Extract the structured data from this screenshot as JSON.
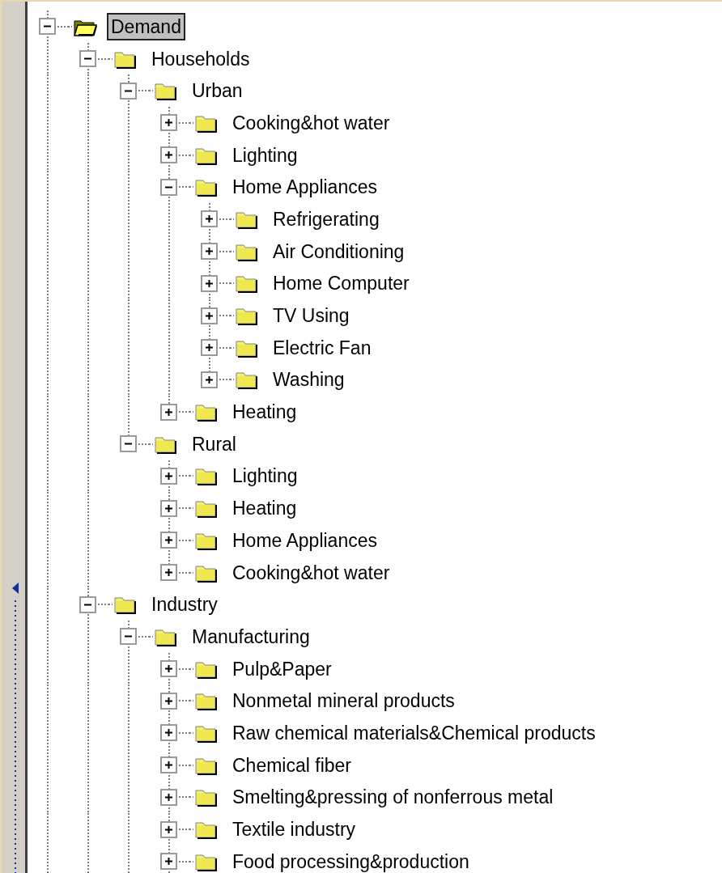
{
  "tree": [
    {
      "label": "Demand",
      "expanded": true,
      "selected": true,
      "children": [
        {
          "label": "Households",
          "expanded": true,
          "selected": false,
          "children": [
            {
              "label": "Urban",
              "expanded": true,
              "selected": false,
              "children": [
                {
                  "label": "Cooking&hot water",
                  "expanded": false,
                  "selected": false
                },
                {
                  "label": "Lighting",
                  "expanded": false,
                  "selected": false
                },
                {
                  "label": "Home Appliances",
                  "expanded": true,
                  "selected": false,
                  "children": [
                    {
                      "label": "Refrigerating",
                      "expanded": false,
                      "selected": false
                    },
                    {
                      "label": "Air Conditioning",
                      "expanded": false,
                      "selected": false
                    },
                    {
                      "label": "Home Computer",
                      "expanded": false,
                      "selected": false
                    },
                    {
                      "label": "TV Using",
                      "expanded": false,
                      "selected": false
                    },
                    {
                      "label": "Electric Fan",
                      "expanded": false,
                      "selected": false
                    },
                    {
                      "label": "Washing",
                      "expanded": false,
                      "selected": false
                    }
                  ]
                },
                {
                  "label": "Heating",
                  "expanded": false,
                  "selected": false
                }
              ]
            },
            {
              "label": "Rural",
              "expanded": true,
              "selected": false,
              "children": [
                {
                  "label": "Lighting",
                  "expanded": false,
                  "selected": false
                },
                {
                  "label": "Heating",
                  "expanded": false,
                  "selected": false
                },
                {
                  "label": "Home Appliances",
                  "expanded": false,
                  "selected": false
                },
                {
                  "label": "Cooking&hot water",
                  "expanded": false,
                  "selected": false
                }
              ]
            }
          ]
        },
        {
          "label": "Industry",
          "expanded": true,
          "selected": false,
          "children": [
            {
              "label": "Manufacturing",
              "expanded": true,
              "selected": false,
              "children": [
                {
                  "label": "Pulp&Paper",
                  "expanded": false,
                  "selected": false
                },
                {
                  "label": "Nonmetal mineral products",
                  "expanded": false,
                  "selected": false
                },
                {
                  "label": "Raw chemical materials&Chemical products",
                  "expanded": false,
                  "selected": false
                },
                {
                  "label": "Chemical fiber",
                  "expanded": false,
                  "selected": false
                },
                {
                  "label": "Smelting&pressing of nonferrous metal",
                  "expanded": false,
                  "selected": false
                },
                {
                  "label": "Textile industry",
                  "expanded": false,
                  "selected": false
                },
                {
                  "label": "Food processing&production",
                  "expanded": false,
                  "selected": false
                }
              ]
            }
          ]
        }
      ]
    }
  ]
}
